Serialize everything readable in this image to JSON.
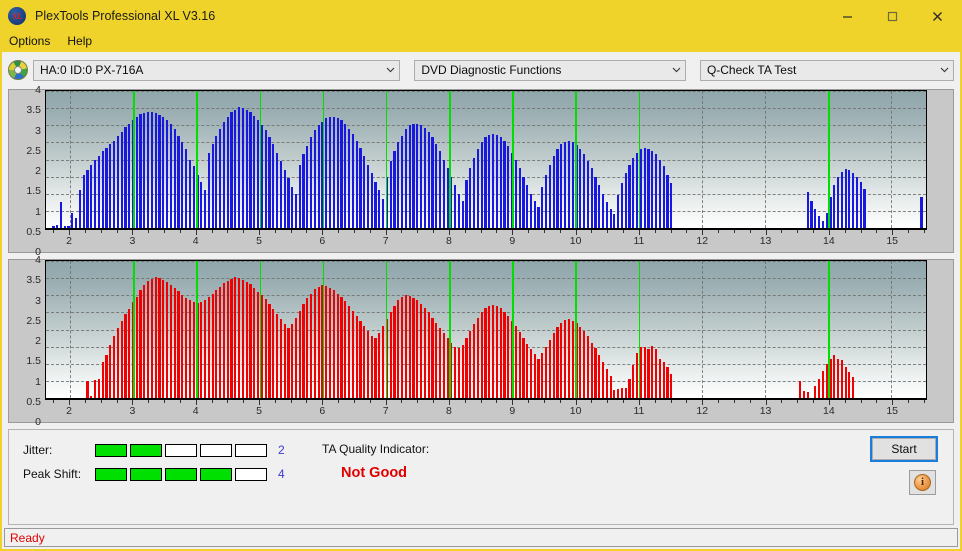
{
  "window": {
    "title": "PlexTools Professional XL V3.16",
    "app_icon": "xl-logo-icon",
    "minimize": "minimize-icon",
    "maximize": "maximize-icon",
    "close": "close-icon",
    "titlebar_color": "#f0d32a"
  },
  "menu": {
    "items": [
      {
        "label": "Options"
      },
      {
        "label": "Help"
      }
    ]
  },
  "selectors": {
    "drive": {
      "value": "HA:0 ID:0  PX-716A",
      "icon": "disc-icon"
    },
    "function": {
      "value": "DVD Diagnostic Functions"
    },
    "test": {
      "value": "Q-Check TA Test"
    }
  },
  "charts": {
    "yticks": [
      "4",
      "3.5",
      "3",
      "2.5",
      "2",
      "1.5",
      "1",
      "0.5",
      "0"
    ],
    "xticks": [
      "2",
      "3",
      "4",
      "5",
      "6",
      "7",
      "8",
      "9",
      "10",
      "11",
      "12",
      "13",
      "14",
      "15"
    ],
    "marker_color": "#00e000",
    "top": {
      "name": "jitter-chart",
      "color": "#1818e0"
    },
    "bottom": {
      "name": "peak-shift-chart",
      "color": "#f00000"
    }
  },
  "chart_data": [
    {
      "type": "bar",
      "name": "ta-test-top-chart",
      "title": "",
      "xlabel": "",
      "ylabel": "",
      "xlim": [
        1.62,
        15.55
      ],
      "ylim": [
        0,
        4
      ],
      "grid": true,
      "series_color": "#1818e0",
      "markers": [
        3,
        4,
        5,
        6,
        7,
        8,
        9,
        10,
        11,
        14
      ],
      "x": [
        1.72,
        1.78,
        1.84,
        1.9,
        1.96,
        2.02,
        2.08,
        2.14,
        2.2,
        2.26,
        2.32,
        2.38,
        2.44,
        2.5,
        2.56,
        2.62,
        2.68,
        2.74,
        2.8,
        2.86,
        2.92,
        2.98,
        3.04,
        3.1,
        3.16,
        3.22,
        3.28,
        3.34,
        3.4,
        3.46,
        3.52,
        3.58,
        3.64,
        3.7,
        3.76,
        3.82,
        3.88,
        3.94,
        4.0,
        4.06,
        4.12,
        4.18,
        4.24,
        4.3,
        4.36,
        4.42,
        4.48,
        4.54,
        4.6,
        4.66,
        4.72,
        4.78,
        4.84,
        4.9,
        4.96,
        5.02,
        5.08,
        5.14,
        5.2,
        5.26,
        5.32,
        5.38,
        5.44,
        5.5,
        5.56,
        5.62,
        5.68,
        5.74,
        5.8,
        5.86,
        5.92,
        5.98,
        6.04,
        6.1,
        6.16,
        6.22,
        6.28,
        6.34,
        6.4,
        6.46,
        6.52,
        6.58,
        6.64,
        6.7,
        6.76,
        6.82,
        6.88,
        6.94,
        7.0,
        7.06,
        7.12,
        7.18,
        7.24,
        7.3,
        7.36,
        7.42,
        7.48,
        7.54,
        7.6,
        7.66,
        7.72,
        7.78,
        7.84,
        7.9,
        7.96,
        8.02,
        8.08,
        8.14,
        8.2,
        8.26,
        8.32,
        8.38,
        8.44,
        8.5,
        8.56,
        8.62,
        8.68,
        8.74,
        8.8,
        8.86,
        8.92,
        8.98,
        9.04,
        9.1,
        9.16,
        9.22,
        9.28,
        9.34,
        9.4,
        9.46,
        9.52,
        9.58,
        9.64,
        9.7,
        9.76,
        9.82,
        9.88,
        9.94,
        10.0,
        10.06,
        10.12,
        10.18,
        10.24,
        10.3,
        10.36,
        10.42,
        10.48,
        10.54,
        10.6,
        10.66,
        10.72,
        10.78,
        10.84,
        10.9,
        10.96,
        11.02,
        11.08,
        11.14,
        11.2,
        11.26,
        11.32,
        11.38,
        11.44,
        11.5,
        13.66,
        13.72,
        13.78,
        13.84,
        13.9,
        13.96,
        14.02,
        14.08,
        14.14,
        14.2,
        14.26,
        14.32,
        14.38,
        14.44,
        14.5,
        14.56,
        15.46
      ],
      "values": [
        0.05,
        0.08,
        0.75,
        0.05,
        0.06,
        0.45,
        0.3,
        1.1,
        1.55,
        1.7,
        1.85,
        2.0,
        2.1,
        2.25,
        2.35,
        2.45,
        2.55,
        2.7,
        2.8,
        2.95,
        3.05,
        3.15,
        3.25,
        3.32,
        3.35,
        3.38,
        3.38,
        3.36,
        3.3,
        3.25,
        3.15,
        3.05,
        2.9,
        2.7,
        2.5,
        2.3,
        2.0,
        1.8,
        1.55,
        1.35,
        1.1,
        2.2,
        2.45,
        2.7,
        2.9,
        3.1,
        3.25,
        3.4,
        3.45,
        3.52,
        3.5,
        3.45,
        3.38,
        3.28,
        3.15,
        3.0,
        2.85,
        2.65,
        2.45,
        2.2,
        1.95,
        1.7,
        1.45,
        1.2,
        1.0,
        1.85,
        2.15,
        2.4,
        2.65,
        2.85,
        3.0,
        3.1,
        3.2,
        3.25,
        3.25,
        3.22,
        3.15,
        3.05,
        2.9,
        2.75,
        2.55,
        2.35,
        2.1,
        1.85,
        1.6,
        1.35,
        1.1,
        0.85,
        1.5,
        1.95,
        2.25,
        2.5,
        2.7,
        2.9,
        3.0,
        3.05,
        3.05,
        3.0,
        2.92,
        2.8,
        2.65,
        2.45,
        2.25,
        2.0,
        1.75,
        1.5,
        1.25,
        1.0,
        0.8,
        1.4,
        1.75,
        2.05,
        2.3,
        2.5,
        2.65,
        2.72,
        2.75,
        2.72,
        2.65,
        2.55,
        2.4,
        2.2,
        2.0,
        1.75,
        1.5,
        1.25,
        1.0,
        0.8,
        0.6,
        1.2,
        1.55,
        1.85,
        2.1,
        2.3,
        2.45,
        2.52,
        2.55,
        2.5,
        2.42,
        2.3,
        2.15,
        1.95,
        1.75,
        1.5,
        1.25,
        1.0,
        0.75,
        0.55,
        0.4,
        0.95,
        1.3,
        1.6,
        1.85,
        2.05,
        2.2,
        2.3,
        2.35,
        2.32,
        2.25,
        2.15,
        2.0,
        1.8,
        1.55,
        1.3,
        1.05,
        0.8,
        0.55,
        0.35,
        0.2,
        0.45,
        0.9,
        1.25,
        1.5,
        1.65,
        1.72,
        1.7,
        1.62,
        1.5,
        1.35,
        1.15,
        0.9,
        0.7,
        0.48,
        0.3,
        0.15,
        0.2,
        0.35,
        0.55,
        0.75,
        0.95,
        1.25,
        1.55,
        1.72,
        1.8,
        1.82,
        1.78,
        1.72,
        1.6,
        1.42,
        1.2,
        0.95,
        0.7,
        0.45,
        0.25,
        0.1,
        0.22
      ]
    },
    {
      "type": "bar",
      "name": "ta-test-bottom-chart",
      "title": "",
      "xlabel": "",
      "ylabel": "",
      "xlim": [
        1.62,
        15.55
      ],
      "ylim": [
        0,
        4
      ],
      "grid": true,
      "series_color": "#f00000",
      "markers": [
        3,
        4,
        5,
        6,
        7,
        8,
        9,
        10,
        11,
        14
      ],
      "x": [
        2.26,
        2.32,
        2.38,
        2.44,
        2.5,
        2.56,
        2.62,
        2.68,
        2.74,
        2.8,
        2.86,
        2.92,
        2.98,
        3.04,
        3.1,
        3.16,
        3.22,
        3.28,
        3.34,
        3.4,
        3.46,
        3.52,
        3.58,
        3.64,
        3.7,
        3.76,
        3.82,
        3.88,
        3.94,
        4.0,
        4.06,
        4.12,
        4.18,
        4.24,
        4.3,
        4.36,
        4.42,
        4.48,
        4.54,
        4.6,
        4.66,
        4.72,
        4.78,
        4.84,
        4.9,
        4.96,
        5.02,
        5.08,
        5.14,
        5.2,
        5.26,
        5.32,
        5.38,
        5.44,
        5.5,
        5.56,
        5.62,
        5.68,
        5.74,
        5.8,
        5.86,
        5.92,
        5.98,
        6.04,
        6.1,
        6.16,
        6.22,
        6.28,
        6.34,
        6.4,
        6.46,
        6.52,
        6.58,
        6.64,
        6.7,
        6.76,
        6.82,
        6.88,
        6.94,
        7.0,
        7.06,
        7.12,
        7.18,
        7.24,
        7.3,
        7.36,
        7.42,
        7.48,
        7.54,
        7.6,
        7.66,
        7.72,
        7.78,
        7.84,
        7.9,
        7.96,
        8.02,
        8.08,
        8.14,
        8.2,
        8.26,
        8.32,
        8.38,
        8.44,
        8.5,
        8.56,
        8.62,
        8.68,
        8.74,
        8.8,
        8.86,
        8.92,
        8.98,
        9.04,
        9.1,
        9.16,
        9.22,
        9.28,
        9.34,
        9.4,
        9.46,
        9.52,
        9.58,
        9.64,
        9.7,
        9.76,
        9.82,
        9.88,
        9.94,
        10.0,
        10.06,
        10.12,
        10.18,
        10.24,
        10.3,
        10.36,
        10.42,
        10.48,
        10.54,
        10.6,
        10.66,
        10.72,
        10.78,
        10.84,
        10.9,
        10.96,
        11.02,
        11.08,
        11.14,
        11.2,
        11.26,
        11.32,
        11.38,
        11.44,
        11.5,
        13.54,
        13.6,
        13.66,
        13.78,
        13.84,
        13.9,
        13.96,
        14.02,
        14.08,
        14.14,
        14.2,
        14.26,
        14.32,
        14.38
      ],
      "values": [
        0.5,
        0.05,
        0.52,
        0.55,
        1.05,
        1.25,
        1.55,
        1.8,
        2.05,
        2.25,
        2.45,
        2.6,
        2.8,
        2.95,
        3.15,
        3.3,
        3.42,
        3.48,
        3.52,
        3.5,
        3.45,
        3.38,
        3.3,
        3.22,
        3.12,
        3.0,
        2.92,
        2.85,
        2.8,
        2.78,
        2.8,
        2.85,
        2.95,
        3.05,
        3.15,
        3.25,
        3.35,
        3.42,
        3.48,
        3.52,
        3.5,
        3.46,
        3.4,
        3.32,
        3.22,
        3.1,
        3.0,
        2.88,
        2.75,
        2.6,
        2.45,
        2.3,
        2.15,
        2.05,
        2.15,
        2.35,
        2.55,
        2.75,
        2.92,
        3.05,
        3.18,
        3.25,
        3.3,
        3.28,
        3.22,
        3.15,
        3.05,
        2.95,
        2.82,
        2.7,
        2.55,
        2.4,
        2.25,
        2.1,
        1.95,
        1.8,
        1.75,
        1.9,
        2.1,
        2.3,
        2.5,
        2.7,
        2.85,
        2.95,
        3.0,
        2.98,
        2.92,
        2.85,
        2.75,
        2.62,
        2.5,
        2.35,
        2.2,
        2.05,
        1.9,
        1.75,
        1.6,
        1.5,
        1.45,
        1.55,
        1.75,
        1.95,
        2.15,
        2.35,
        2.5,
        2.62,
        2.7,
        2.72,
        2.68,
        2.62,
        2.52,
        2.4,
        2.25,
        2.1,
        1.92,
        1.75,
        1.58,
        1.42,
        1.28,
        1.15,
        1.3,
        1.5,
        1.7,
        1.9,
        2.08,
        2.2,
        2.28,
        2.3,
        2.26,
        2.18,
        2.08,
        1.95,
        1.8,
        1.62,
        1.45,
        1.25,
        1.05,
        0.85,
        0.65,
        0.22,
        0.25,
        0.28,
        0.3,
        0.55,
        0.95,
        1.3,
        1.5,
        1.48,
        1.42,
        1.52,
        1.42,
        1.15,
        1.05,
        0.9,
        0.7,
        0.5,
        0.2,
        0.18,
        0.35,
        0.55,
        0.8,
        1.0,
        1.15,
        1.25,
        1.15,
        1.1,
        0.9,
        0.75,
        0.6
      ]
    }
  ],
  "indicators": {
    "jitter": {
      "label": "Jitter:",
      "value": "2",
      "filled": 2,
      "total": 5
    },
    "peak_shift": {
      "label": "Peak Shift:",
      "value": "4",
      "filled": 4,
      "total": 5
    },
    "ta_quality": {
      "label": "TA Quality Indicator:",
      "value": "Not Good",
      "color": "#e00000"
    }
  },
  "actions": {
    "start": "Start",
    "info": "i"
  },
  "statusbar": {
    "text": "Ready",
    "color": "#e00000"
  }
}
